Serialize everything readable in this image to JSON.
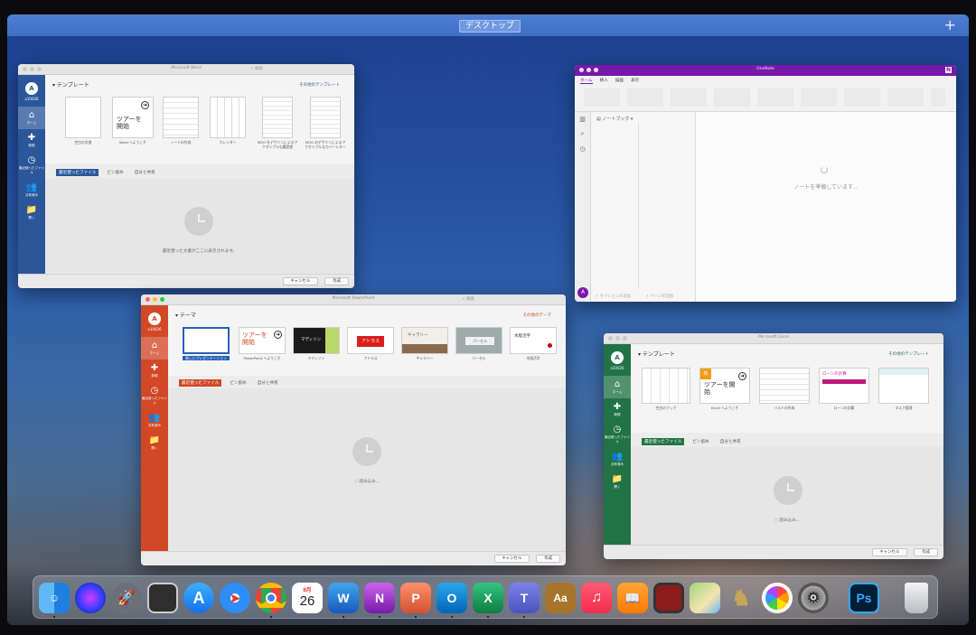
{
  "mission_control": {
    "space_label": "デスクトップ",
    "add_space": "+"
  },
  "word": {
    "title": "Microsoft Word",
    "search_placeholder": "検索",
    "accent": "#2b579a",
    "user": {
      "initial": "A",
      "name": "a10026"
    },
    "sidebar": [
      {
        "icon": "⌂",
        "label": "ホーム"
      },
      {
        "icon": "✚",
        "label": "新規"
      },
      {
        "icon": "◷",
        "label": "最近使ったファイル"
      },
      {
        "icon": "👥",
        "label": "共有済み"
      },
      {
        "icon": "📁",
        "label": "開く"
      }
    ],
    "section_title": "テンプレート",
    "more_templates": "その他のテンプレート",
    "templates": [
      {
        "caption": "空白の文書"
      },
      {
        "caption": "Word へようこそ",
        "thumb_text": "ツアーを開始"
      },
      {
        "caption": "ノートの作成"
      },
      {
        "caption": "カレンダー"
      },
      {
        "caption": "MOO をデザインによるアクセシブルな履歴書"
      },
      {
        "caption": "MOO のデザインによるアクセシブルなカバーレター"
      }
    ],
    "tabs": [
      "最近使ったファイル",
      "ピン留め",
      "自分と共有"
    ],
    "empty_message": "最近使った文書がここに表示されます。",
    "cancel": "キャンセル",
    "create": "作成"
  },
  "onenote": {
    "title": "OneNote",
    "accent": "#7719aa",
    "user_initial": "A",
    "tabs": [
      "ホーム",
      "挿入",
      "描画",
      "表示"
    ],
    "notebook_label": "ノートブック",
    "add_section": "＋ セクションの追加",
    "add_page": "＋ ページの追加",
    "loading": "ノートを準備しています..."
  },
  "powerpoint": {
    "title": "Microsoft PowerPoint",
    "search_placeholder": "検索",
    "accent": "#d24726",
    "user": {
      "initial": "A",
      "name": "a10026"
    },
    "sidebar": [
      {
        "icon": "⌂",
        "label": "ホーム"
      },
      {
        "icon": "✚",
        "label": "新規"
      },
      {
        "icon": "◷",
        "label": "最近使ったファイル"
      },
      {
        "icon": "👥",
        "label": "共有済み"
      },
      {
        "icon": "📁",
        "label": "開く"
      }
    ],
    "section_title": "テーマ",
    "more_themes": "その他のテーマ",
    "templates": [
      {
        "caption": "新しいプレゼンテーション",
        "selected": true
      },
      {
        "caption": "PowerPoint へようこそ",
        "thumb_text": "ツアーを開始"
      },
      {
        "caption": "マディソン",
        "thumb_text": "マディソン"
      },
      {
        "caption": "アトラス",
        "thumb_text": "アトラス"
      },
      {
        "caption": "ギャラリー",
        "thumb_text": "ギャラリー"
      },
      {
        "caption": "パーセル",
        "thumb_text": "パーセル"
      },
      {
        "caption": "木版活字",
        "thumb_text": "木版活字"
      }
    ],
    "tabs": [
      "最近使ったファイル",
      "ピン留め",
      "自分と共有"
    ],
    "loading": "読み込み...",
    "cancel": "キャンセル",
    "create": "作成"
  },
  "excel": {
    "title": "Microsoft Excel",
    "accent": "#217346",
    "user": {
      "initial": "A",
      "name": "a10026"
    },
    "sidebar": [
      {
        "icon": "⌂",
        "label": "ホーム"
      },
      {
        "icon": "✚",
        "label": "新規"
      },
      {
        "icon": "◷",
        "label": "最近使ったファイル"
      },
      {
        "icon": "👥",
        "label": "共有済み"
      },
      {
        "icon": "📁",
        "label": "開く"
      }
    ],
    "section_title": "テンプレート",
    "more_templates": "その他のテンプレート",
    "templates": [
      {
        "caption": "空白のブック"
      },
      {
        "caption": "Excel へようこそ",
        "thumb_text": "ツアーを開始",
        "badge": "新"
      },
      {
        "caption": "リストの作成"
      },
      {
        "caption": "ローンの計算",
        "thumb_text": "ローンの計算"
      },
      {
        "caption": "タスク管理"
      }
    ],
    "tabs": [
      "最近使ったファイル",
      "ピン留め",
      "自分と共有"
    ],
    "loading": "読み込み...",
    "cancel": "キャンセル",
    "create": "作成"
  },
  "dock": {
    "apps": [
      {
        "name": "Finder",
        "icon": "finder-icon"
      },
      {
        "name": "Siri",
        "icon": "siri-icon"
      },
      {
        "name": "Launchpad",
        "icon": "launchpad-icon"
      },
      {
        "name": "Image Capture",
        "icon": "image-capture-icon"
      },
      {
        "name": "App Store",
        "icon": "app-store-icon"
      },
      {
        "name": "Safari",
        "icon": "safari-icon"
      },
      {
        "name": "Chrome",
        "icon": "chrome-icon"
      },
      {
        "name": "Calendar",
        "icon": "calendar-icon",
        "day": "26",
        "month": "8月"
      },
      {
        "name": "Word",
        "icon": "word-icon",
        "letter": "W"
      },
      {
        "name": "OneNote",
        "icon": "onenote-icon",
        "letter": "N"
      },
      {
        "name": "PowerPoint",
        "icon": "powerpoint-icon",
        "letter": "P"
      },
      {
        "name": "Outlook",
        "icon": "outlook-icon",
        "letter": "O"
      },
      {
        "name": "Excel",
        "icon": "excel-icon",
        "letter": "X"
      },
      {
        "name": "Teams",
        "icon": "teams-icon",
        "letter": "T"
      },
      {
        "name": "Dictionary",
        "icon": "dictionary-icon"
      },
      {
        "name": "Music",
        "icon": "music-icon"
      },
      {
        "name": "Books",
        "icon": "books-icon"
      },
      {
        "name": "Photo Booth",
        "icon": "photo-booth-icon"
      },
      {
        "name": "Maps",
        "icon": "maps-icon"
      },
      {
        "name": "Chess",
        "icon": "chess-icon"
      },
      {
        "name": "Photos",
        "icon": "photos-icon"
      },
      {
        "name": "System Preferences",
        "icon": "system-preferences-icon"
      },
      {
        "name": "Photoshop",
        "icon": "photoshop-icon",
        "letter": "Ps"
      },
      {
        "name": "Trash",
        "icon": "trash-icon"
      }
    ]
  }
}
